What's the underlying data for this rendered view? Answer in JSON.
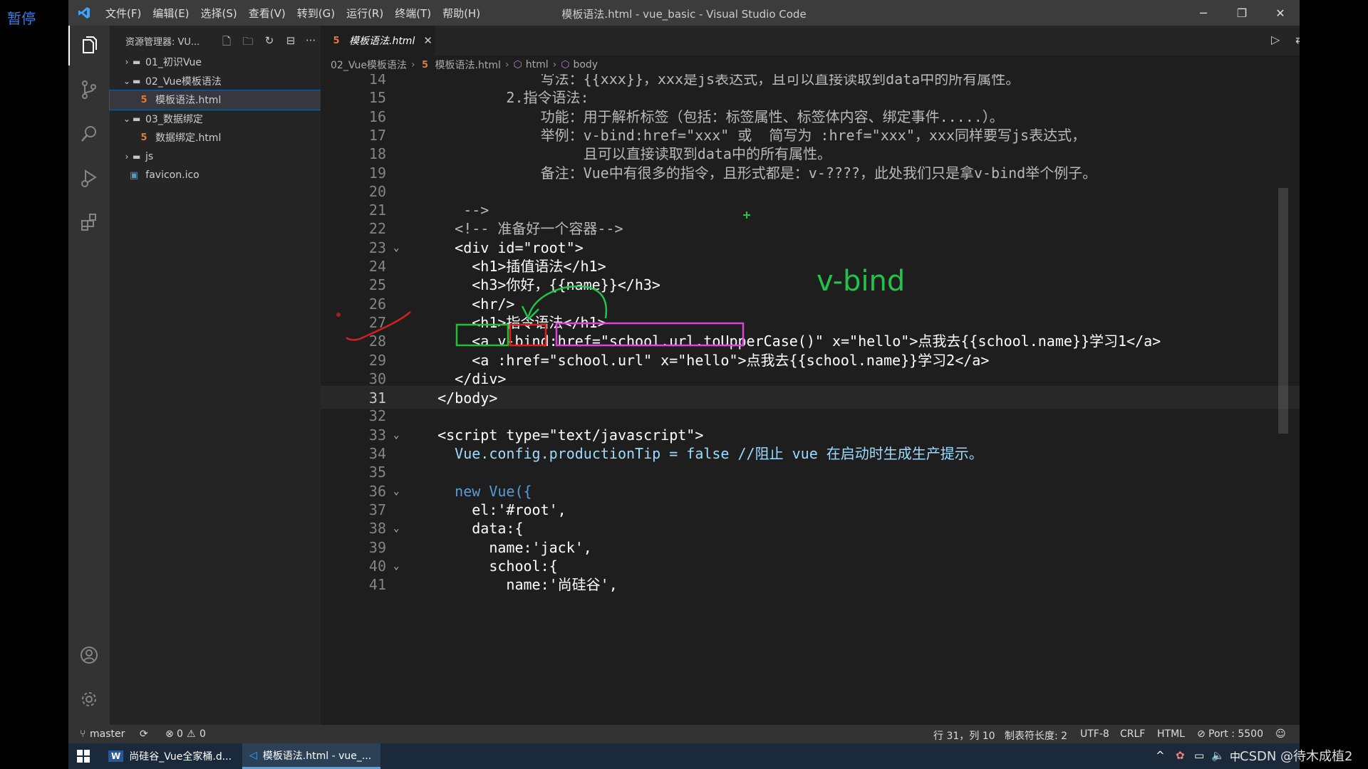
{
  "overlay": {
    "pause_label": "暂停",
    "watermark": "CSDN @待木成植2"
  },
  "titlebar": {
    "menus": [
      "文件(F)",
      "编辑(E)",
      "选择(S)",
      "查看(V)",
      "转到(G)",
      "运行(R)",
      "终端(T)",
      "帮助(H)"
    ],
    "title": "模板语法.html - vue_basic - Visual Studio Code"
  },
  "sidebar": {
    "title": "资源管理器: VU...",
    "tree": [
      {
        "label": "01_初识Vue",
        "type": "folder",
        "expanded": false,
        "depth": 0
      },
      {
        "label": "02_Vue模板语法",
        "type": "folder",
        "expanded": true,
        "depth": 0
      },
      {
        "label": "模板语法.html",
        "type": "html",
        "depth": 1,
        "selected": true
      },
      {
        "label": "03_数据绑定",
        "type": "folder",
        "expanded": true,
        "depth": 0
      },
      {
        "label": "数据绑定.html",
        "type": "html",
        "depth": 1
      },
      {
        "label": "js",
        "type": "folder",
        "expanded": false,
        "depth": 0
      },
      {
        "label": "favicon.ico",
        "type": "ico",
        "depth": 0
      }
    ]
  },
  "tab": {
    "label": "模板语法.html"
  },
  "breadcrumb": [
    "02_Vue模板语法",
    "模板语法.html",
    "html",
    "body"
  ],
  "editor": {
    "current_line": 31,
    "annotation": "v-bind",
    "lines": [
      {
        "n": 14,
        "text": "              写法：{{xxx}}，xxx是js表达式，且可以直接读取到data中的所有属性。",
        "cls": "c-com"
      },
      {
        "n": 15,
        "text": "          2.指令语法:",
        "cls": "c-com"
      },
      {
        "n": 16,
        "text": "              功能：用于解析标签（包括：标签属性、标签体内容、绑定事件.....）。",
        "cls": "c-com"
      },
      {
        "n": 17,
        "text": "              举例：v-bind:href=\"xxx\" 或  简写为 :href=\"xxx\"，xxx同样要写js表达式，",
        "cls": "c-com"
      },
      {
        "n": 18,
        "text": "                   且可以直接读取到data中的所有属性。",
        "cls": "c-com"
      },
      {
        "n": 19,
        "text": "              备注：Vue中有很多的指令，且形式都是：v-????，此处我们只是拿v-bind举个例子。",
        "cls": "c-com"
      },
      {
        "n": 20,
        "text": "",
        "cls": "c-com"
      },
      {
        "n": 21,
        "text": "     -->",
        "cls": "c-com"
      },
      {
        "n": 22,
        "text": "    <!-- 准备好一个容器-->",
        "cls": "c-com"
      },
      {
        "n": 23,
        "text": "    <div id=\"root\">",
        "cls": "c-tag",
        "fold": true
      },
      {
        "n": 24,
        "text": "      <h1>插值语法</h1>",
        "cls": "c-tag"
      },
      {
        "n": 25,
        "text": "      <h3>你好，{{name}}</h3>",
        "cls": "c-tag"
      },
      {
        "n": 26,
        "text": "      <hr/>",
        "cls": "c-tag"
      },
      {
        "n": 27,
        "text": "      <h1>指令语法</h1>",
        "cls": "c-tag"
      },
      {
        "n": 28,
        "text": "      <a v-bind:href=\"school.url.toUpperCase()\" x=\"hello\">点我去{{school.name}}学习1</a>",
        "cls": "c-tag"
      },
      {
        "n": 29,
        "text": "      <a :href=\"school.url\" x=\"hello\">点我去{{school.name}}学习2</a>",
        "cls": "c-tag"
      },
      {
        "n": 30,
        "text": "    </div>",
        "cls": "c-tag"
      },
      {
        "n": 31,
        "text": "  </body>",
        "cls": "c-tag"
      },
      {
        "n": 32,
        "text": "",
        "cls": "c-tag"
      },
      {
        "n": 33,
        "text": "  <script type=\"text/javascript\">",
        "cls": "c-tag",
        "fold": true
      },
      {
        "n": 34,
        "text": "    Vue.config.productionTip = false //阻止 vue 在启动时生成生产提示。",
        "cls": "c-prop"
      },
      {
        "n": 35,
        "text": "",
        "cls": "c-txt"
      },
      {
        "n": 36,
        "text": "    new Vue({",
        "cls": "c-kw",
        "fold": true
      },
      {
        "n": 37,
        "text": "      el:'#root',",
        "cls": "c-txt"
      },
      {
        "n": 38,
        "text": "      data:{",
        "cls": "c-txt",
        "fold": true
      },
      {
        "n": 39,
        "text": "        name:'jack',",
        "cls": "c-txt"
      },
      {
        "n": 40,
        "text": "        school:{",
        "cls": "c-txt",
        "fold": true
      },
      {
        "n": 41,
        "text": "          name:'尚硅谷',",
        "cls": "c-txt"
      }
    ]
  },
  "statusbar": {
    "branch": "master",
    "errors": "0",
    "warnings": "0",
    "position": "行 31，列 10",
    "tab_size": "制表符长度: 2",
    "encoding": "UTF-8",
    "eol": "CRLF",
    "language": "HTML",
    "port": "Port : 5500"
  },
  "taskbar": {
    "items": [
      "尚硅谷_Vue全家桶.d...",
      "模板语法.html - vue_..."
    ],
    "ime": "中"
  },
  "colors": {
    "annotation_green": "#22c34a",
    "box_green": "#20c030",
    "box_red": "#e02020",
    "box_pink": "#e040e0",
    "accent": "#0e639c"
  }
}
